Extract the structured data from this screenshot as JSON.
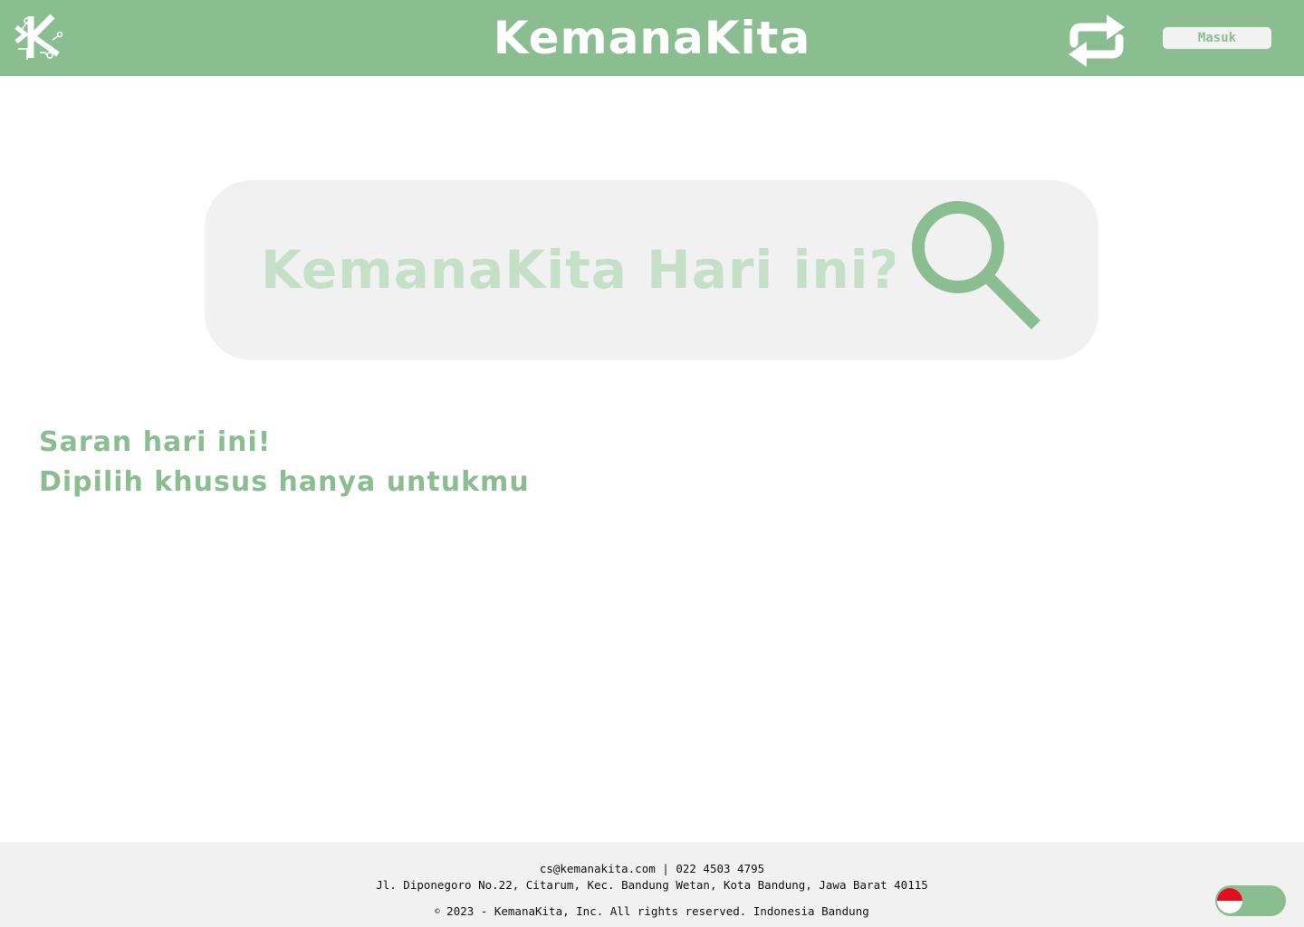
{
  "header": {
    "logo_text": "K",
    "title": "KemanaKita",
    "swap_icon": "swap-arrows-icon",
    "login_label": "Masuk"
  },
  "search": {
    "placeholder": "KemanaKita Hari ini?",
    "icon": "search-icon"
  },
  "suggestions": {
    "title": "Saran hari ini!",
    "subtitle": "Dipilih khusus hanya untukmu"
  },
  "footer": {
    "contact": "cs@kemanakita.com | 022 4503 4795",
    "address": "Jl. Diponegoro No.22, Citarum, Kec. Bandung Wetan, Kota Bandung, Jawa Barat 40115",
    "copyright_symbol": "©",
    "copyright": " 2023 - KemanaKita, Inc. All rights reserved. Indonesia Bandung",
    "language_flag": "indonesia-flag-icon"
  },
  "colors": {
    "primary": "#8abe91",
    "placeholder": "#c4e0c7",
    "surface": "#f1f1f1",
    "flag_red": "#e1101f"
  }
}
